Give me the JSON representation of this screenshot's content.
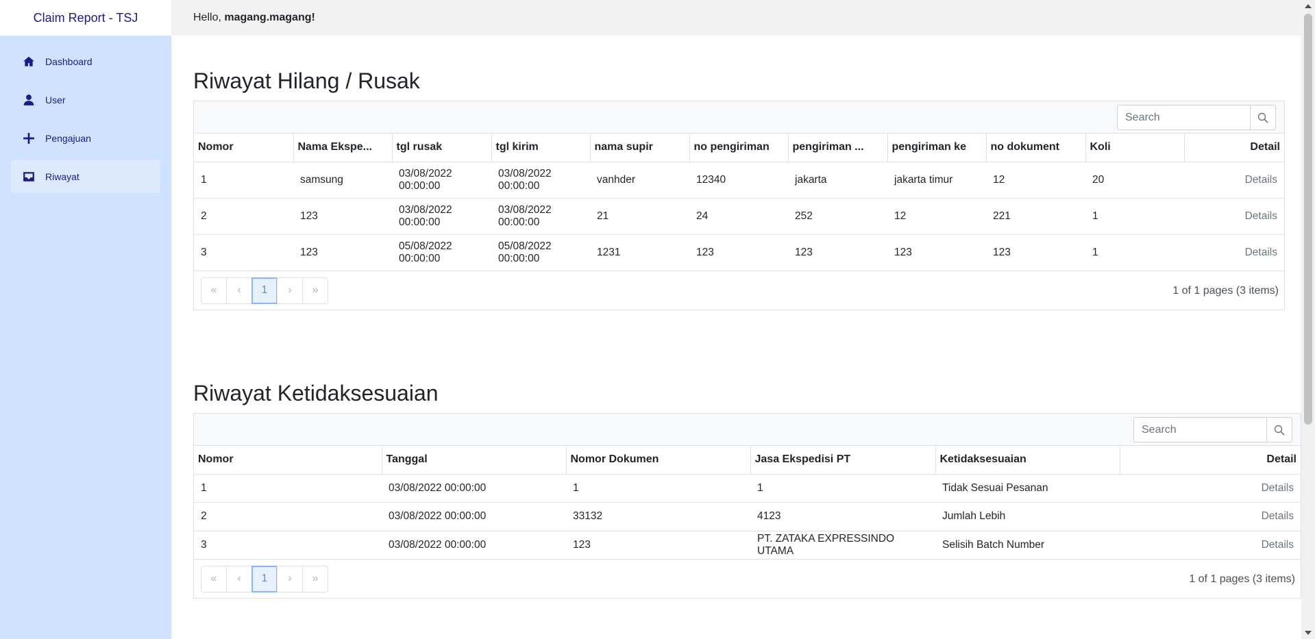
{
  "brand": "Claim Report - TSJ",
  "greeting": {
    "prefix": "Hello, ",
    "user": "magang.magang!"
  },
  "nav": [
    {
      "label": "Dashboard",
      "icon": "home-icon"
    },
    {
      "label": "User",
      "icon": "user-icon"
    },
    {
      "label": "Pengajuan",
      "icon": "plus-icon"
    },
    {
      "label": "Riwayat",
      "icon": "inbox-icon",
      "active": true
    }
  ],
  "section1": {
    "title": "Riwayat Hilang / Rusak",
    "search_placeholder": "Search",
    "columns": [
      "Nomor",
      "Nama Ekspe...",
      "tgl rusak",
      "tgl kirim",
      "nama supir",
      "no pengiriman",
      "pengiriman ...",
      "pengiriman ke",
      "no dokument",
      "Koli",
      "Detail"
    ],
    "rows": [
      [
        "1",
        "samsung",
        "03/08/2022 00:00:00",
        "03/08/2022 00:00:00",
        "vanhder",
        "12340",
        "jakarta",
        "jakarta timur",
        "12",
        "20",
        "Details"
      ],
      [
        "2",
        "123",
        "03/08/2022 00:00:00",
        "03/08/2022 00:00:00",
        "21",
        "24",
        "252",
        "12",
        "221",
        "1",
        "Details"
      ],
      [
        "3",
        "123",
        "05/08/2022 00:00:00",
        "05/08/2022 00:00:00",
        "1231",
        "123",
        "123",
        "123",
        "123",
        "1",
        "Details"
      ]
    ],
    "pager": {
      "first": "«",
      "prev": "‹",
      "current": "1",
      "next": "›",
      "last": "»"
    },
    "page_info": "1 of 1 pages (3 items)"
  },
  "section2": {
    "title": "Riwayat Ketidaksesuaian",
    "search_placeholder": "Search",
    "columns": [
      "Nomor",
      "Tanggal",
      "Nomor Dokumen",
      "Jasa Ekspedisi PT",
      "Ketidaksesuaian",
      "Detail"
    ],
    "rows": [
      [
        "1",
        "03/08/2022 00:00:00",
        "1",
        "1",
        "Tidak Sesuai Pesanan",
        "Details"
      ],
      [
        "2",
        "03/08/2022 00:00:00",
        "33132",
        "4123",
        "Jumlah Lebih",
        "Details"
      ],
      [
        "3",
        "03/08/2022 00:00:00",
        "123",
        "PT. ZATAKA EXPRESSINDO UTAMA",
        "Selisih Batch Number",
        "Details"
      ]
    ],
    "pager": {
      "first": "«",
      "prev": "‹",
      "current": "1",
      "next": "›",
      "last": "»"
    },
    "page_info": "1 of 1 pages (3 items)"
  }
}
